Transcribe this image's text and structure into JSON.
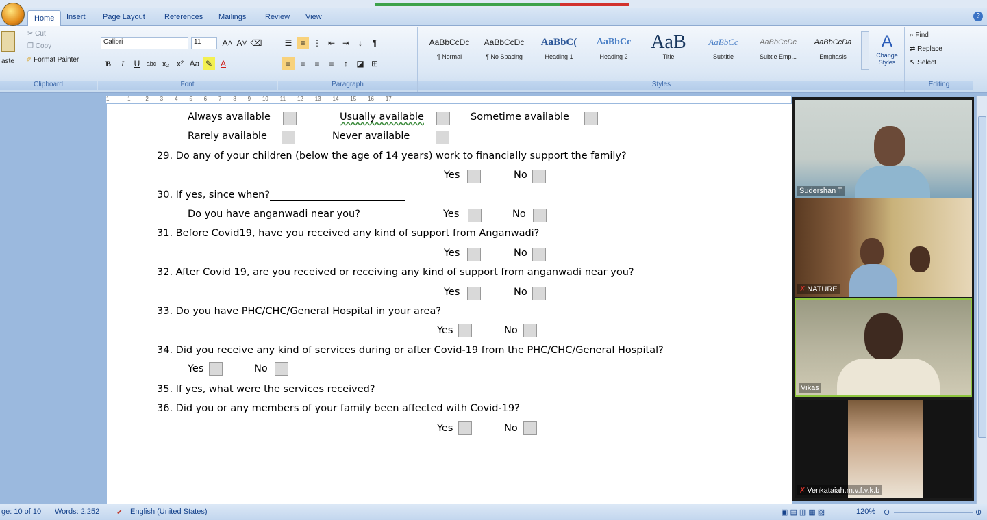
{
  "tabs": [
    "Home",
    "Insert",
    "Page Layout",
    "References",
    "Mailings",
    "Review",
    "View"
  ],
  "clipboard": {
    "paste": "aste",
    "cut": "Cut",
    "copy": "Copy",
    "format_painter": "Format Painter",
    "label": "Clipboard"
  },
  "font": {
    "name": "Calibri",
    "size": "11",
    "label": "Font"
  },
  "paragraph": {
    "label": "Paragraph"
  },
  "styles": {
    "label": "Styles",
    "items": [
      {
        "sample": "AaBbCcDc",
        "name": "¶ Normal"
      },
      {
        "sample": "AaBbCcDc",
        "name": "¶ No Spacing"
      },
      {
        "sample": "AaBbC(",
        "name": "Heading 1"
      },
      {
        "sample": "AaBbCc",
        "name": "Heading 2"
      },
      {
        "sample": "AaB",
        "name": "Title"
      },
      {
        "sample": "AaBbCc",
        "name": "Subtitle"
      },
      {
        "sample": "AaBbCcDc",
        "name": "Subtle Emp..."
      },
      {
        "sample": "AaBbCcDa",
        "name": "Emphasis"
      }
    ],
    "change_styles": "Change Styles"
  },
  "editing": {
    "find": "Find",
    "replace": "Replace",
    "select": "Select",
    "label": "Editing"
  },
  "ruler_text": "1 · · · · · 1 · · · · 2 · · · 3 · · · 4 · · · 5 · · · 6 · · · 7 · · · 8 · · · 9 · · · 10 · · · 11 · · · 12 · · · 13 · · · 14 · · · 15 · · · 16 · · · 17 · ·",
  "doc": {
    "always": "Always available",
    "usually": "Usually available",
    "sometime": "Sometime available",
    "rarely": "Rarely available",
    "never": "Never available",
    "q29": "29.  Do any of your children (below the age of 14 years) work to financially support the family?",
    "q30": "30.  If yes, since when?",
    "q30b": "Do you have anganwadi near you?",
    "q31": "31.  Before Covid19, have you received any kind of support from Anganwadi?",
    "q32": "32.  After Covid 19, are you received or receiving any kind of support from anganwadi near you?",
    "q33": "33.  Do you have PHC/CHC/General  Hospital in your area?",
    "q34": "34.  Did you receive any kind of services during or after Covid-19 from the PHC/CHC/General  Hospital?",
    "q35": "35.  If yes, what were the services received?",
    "q36": "36.  Did you or any members of your family been affected with Covid-19?",
    "yes": "Yes",
    "no": "No"
  },
  "participants": [
    "Sudershan T",
    "NATURE",
    "Vikas",
    "Venkataiah.m.v.f.v.k.b"
  ],
  "status": {
    "page": "ge: 10 of 10",
    "words": "Words: 2,252",
    "language": "English (United States)",
    "zoom": "120%"
  }
}
